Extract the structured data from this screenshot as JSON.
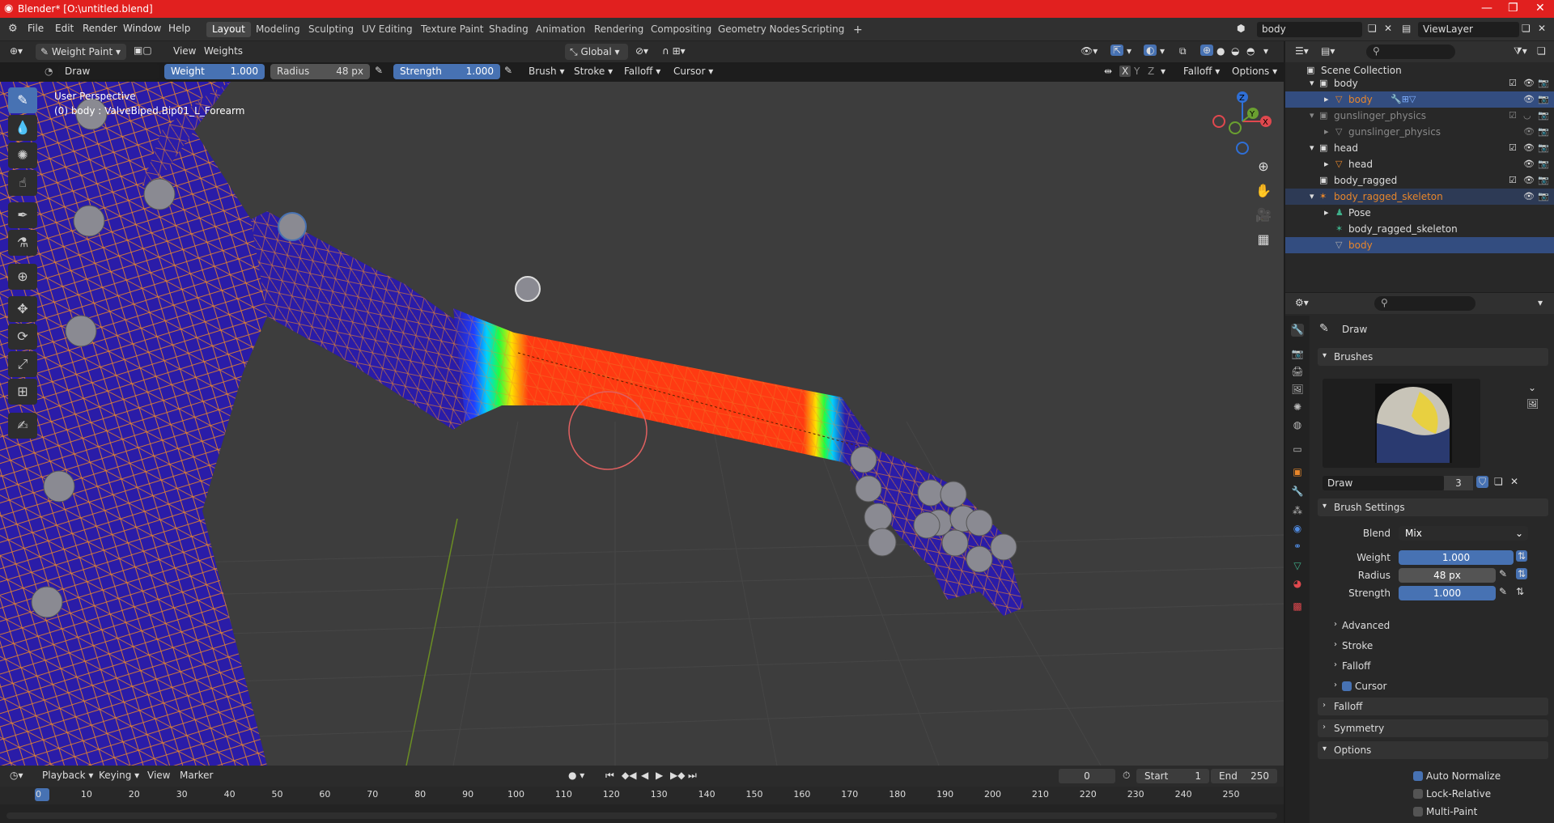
{
  "window": {
    "title": "Blender* [O:\\untitled.blend]"
  },
  "menu": [
    "File",
    "Edit",
    "Render",
    "Window",
    "Help"
  ],
  "workspaces": [
    "Layout",
    "Modeling",
    "Sculpting",
    "UV Editing",
    "Texture Paint",
    "Shading",
    "Animation",
    "Rendering",
    "Compositing",
    "Geometry Nodes",
    "Scripting"
  ],
  "active_workspace": "Layout",
  "scene_field": "body",
  "view_layer": "ViewLayer",
  "viewport_header": {
    "mode": "Weight Paint",
    "view": "View",
    "weights": "Weights",
    "orientation": "Global"
  },
  "tool_header": {
    "brush_name": "Draw",
    "weight_label": "Weight",
    "weight_value": "1.000",
    "radius_label": "Radius",
    "radius_value": "48 px",
    "strength_label": "Strength",
    "strength_value": "1.000",
    "brush": "Brush",
    "stroke": "Stroke",
    "falloff": "Falloff",
    "cursor": "Cursor",
    "axis_x": "X",
    "axis_y": "Y",
    "axis_z": "Z",
    "falloff2": "Falloff",
    "options": "Options"
  },
  "viewport_info": {
    "line1": "User Perspective",
    "line2": "(0) body : ValveBiped.Bip01_L_Forearm"
  },
  "gizmo": {
    "x": "X",
    "y": "Y",
    "z": "Z"
  },
  "outliner": {
    "root": "Scene Collection",
    "rows": [
      {
        "label": "body"
      },
      {
        "label": "body"
      },
      {
        "label": "gunslinger_physics"
      },
      {
        "label": "gunslinger_physics"
      },
      {
        "label": "head"
      },
      {
        "label": "head"
      },
      {
        "label": "body_ragged"
      },
      {
        "label": "body_ragged_skeleton"
      },
      {
        "label": "Pose"
      },
      {
        "label": "body_ragged_skeleton"
      },
      {
        "label": "body"
      }
    ]
  },
  "properties": {
    "tool_name": "Draw",
    "brushes_label": "Brushes",
    "brush_name": "Draw",
    "brush_users": "3",
    "brush_settings": "Brush Settings",
    "blend_label": "Blend",
    "blend_value": "Mix",
    "weight_label": "Weight",
    "weight_value": "1.000",
    "radius_label": "Radius",
    "radius_value": "48 px",
    "strength_label": "Strength",
    "strength_value": "1.000",
    "advanced": "Advanced",
    "stroke": "Stroke",
    "falloff_sub": "Falloff",
    "cursor_sub": "Cursor",
    "falloff": "Falloff",
    "symmetry": "Symmetry",
    "options": "Options",
    "auto_normalize": "Auto Normalize",
    "lock_relative": "Lock-Relative",
    "multi_paint": "Multi-Paint"
  },
  "timeline": {
    "playback": "Playback",
    "keying": "Keying",
    "view": "View",
    "marker": "Marker",
    "current_frame": "0",
    "start_label": "Start",
    "start": "1",
    "end_label": "End",
    "end": "250",
    "ticks": [
      "0",
      "10",
      "20",
      "30",
      "40",
      "50",
      "60",
      "70",
      "80",
      "90",
      "100",
      "110",
      "120",
      "130",
      "140",
      "150",
      "160",
      "170",
      "180",
      "190",
      "200",
      "210",
      "220",
      "230",
      "240",
      "250"
    ]
  },
  "colors": {
    "accent": "#4772b3",
    "titlebar": "#e1201f",
    "mesh_blue": "#2a1ca8",
    "weight_red": "#ff3a12",
    "wire": "#e8862a"
  }
}
